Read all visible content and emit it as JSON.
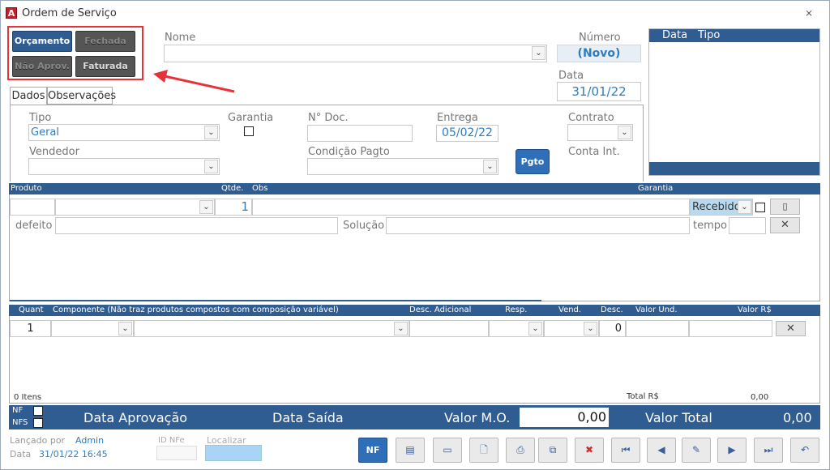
{
  "window": {
    "title": "Ordem de Serviço",
    "app_letter": "A",
    "close_glyph": "⨯"
  },
  "status_buttons": {
    "orcamento": "Orçamento",
    "fechada": "Fechada",
    "nao_aprov": "Não Aprov.",
    "faturada": "Faturada"
  },
  "header": {
    "nome_label": "Nome",
    "nome_value": "",
    "numero_label": "Número",
    "numero_value": "(Novo)",
    "data_label": "Data",
    "data_value": "31/01/22"
  },
  "right_list": {
    "col_data": "Data",
    "col_tipo": "Tipo"
  },
  "tabs": [
    {
      "label": "Dados"
    },
    {
      "label": "Observações"
    }
  ],
  "dados": {
    "tipo_label": "Tipo",
    "tipo_value": "Geral",
    "garantia_label": "Garantia",
    "ndoc_label": "N° Doc.",
    "ndoc_value": "",
    "entrega_label": "Entrega",
    "entrega_value": "05/02/22",
    "contrato_label": "Contrato",
    "vendedor_label": "Vendedor",
    "condicao_label": "Condição Pagto",
    "pgto_button": "Pgto",
    "conta_int_label": "Conta Int."
  },
  "produto_bar": {
    "produto": "Produto",
    "qtde": "Qtde.",
    "obs": "Obs",
    "garantia": "Garantia"
  },
  "produto_row": {
    "qtde_value": "1",
    "status_value": "Recebido",
    "defeito_label": "defeito",
    "solucao_label": "Solução",
    "tempo_label": "tempo"
  },
  "comp_bar": {
    "quant": "Quant",
    "componente": "Componente (Não traz produtos compostos com composição variável)",
    "desc_adicional": "Desc. Adicional",
    "resp": "Resp.",
    "vend": "Vend.",
    "desc": "Desc.",
    "valor_und": "Valor Und.",
    "valor_rs": "Valor R$"
  },
  "comp_row": {
    "quant_value": "1",
    "desc_value": "0"
  },
  "comp_footer": {
    "items": "0 Itens",
    "total_label": "Total R$",
    "total_value": "0,00"
  },
  "summary": {
    "nf": "NF",
    "nfs": "NFS",
    "data_aprovacao": "Data Aprovação",
    "data_saida": "Data Saída",
    "valor_mo_label": "Valor M.O.",
    "valor_mo_value": "0,00",
    "valor_total_label": "Valor Total",
    "valor_total_value": "0,00"
  },
  "footer": {
    "lancado_label": "Lançado por",
    "lancado_value": "Admin",
    "data_label": "Data",
    "data_value": "31/01/22 16:45",
    "idnfe_label": "ID NFe",
    "localizar_label": "Localizar"
  },
  "toolbar": {
    "nf_button": "NF"
  }
}
